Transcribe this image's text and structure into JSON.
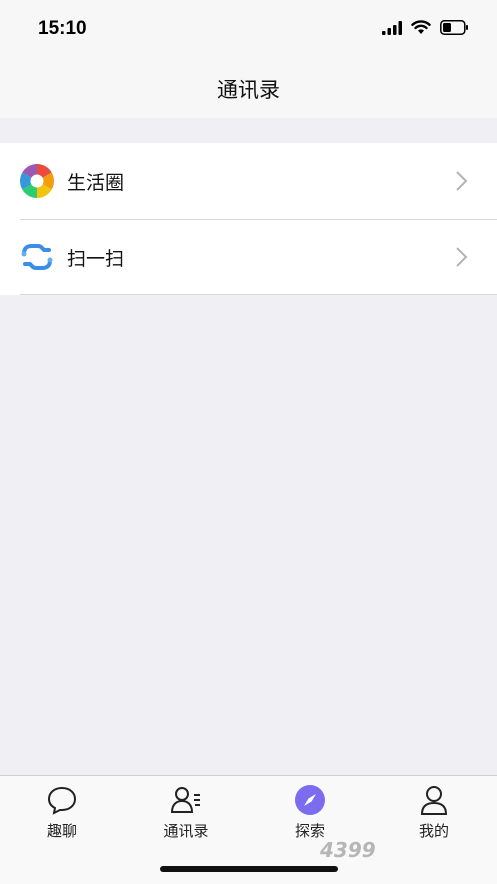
{
  "status_bar": {
    "time": "15:10"
  },
  "nav": {
    "title": "通讯录"
  },
  "list": {
    "items": [
      {
        "label": "生活圈",
        "icon": "aperture-icon"
      },
      {
        "label": "扫一扫",
        "icon": "scan-icon"
      }
    ]
  },
  "tabs": [
    {
      "label": "趣聊",
      "icon": "chat-bubble-icon"
    },
    {
      "label": "通讯录",
      "icon": "contacts-icon"
    },
    {
      "label": "探索",
      "icon": "compass-icon"
    },
    {
      "label": "我的",
      "icon": "person-icon"
    }
  ],
  "watermark": {
    "text": "4399"
  },
  "colors": {
    "background": "#efeff4",
    "accent": "#7b6cf0"
  }
}
